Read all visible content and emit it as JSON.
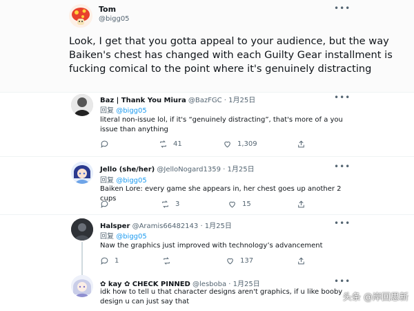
{
  "main_tweet": {
    "name": "Tom",
    "handle": "@bigg05",
    "text": "Look, I get that you gotta appeal to your audience, but the way Baiken's chest has changed with each Guilty Gear installment is fucking comical to the point where it's genuinely distracting",
    "more": "•••"
  },
  "replies": [
    {
      "name": "Baz | Thank You Miura",
      "handle": "@BazFGC · 1月25日",
      "reply_prefix": "回复",
      "reply_to": "@bigg05",
      "text": "literal non-issue lol, if it's “genuinely distracting”, that's more of a you issue than anything",
      "comments": "",
      "retweets": "41",
      "likes": "1,309",
      "more": "•••"
    },
    {
      "name": "Jello (she/her)",
      "handle": "@JelloNogard1359 · 1月25日",
      "reply_prefix": "回复",
      "reply_to": "@bigg05",
      "text": "Baiken Lore: every game she appears in, her chest goes up another 2 cups",
      "comments": "",
      "retweets": "3",
      "likes": "15",
      "more": "•••"
    },
    {
      "name": "Halsper",
      "handle": "@Aramis66482143 · 1月25日",
      "reply_prefix": "回复",
      "reply_to": "@bigg05",
      "text": "Naw the graphics just improved with technology’s advancement",
      "comments": "1",
      "retweets": "",
      "likes": "137",
      "more": "•••"
    },
    {
      "name": "✿ kay ✿ CHECK PINNED",
      "handle": "@lesboba · 1月25日",
      "text": "idk how to tell u that character designs aren't graphics, if u like booby design u can just say that",
      "more": "•••"
    }
  ],
  "watermark": "头条 @岸回思新",
  "colors": {
    "accent": "#1d9bf0",
    "muted": "#536471",
    "text": "#0f1419"
  }
}
